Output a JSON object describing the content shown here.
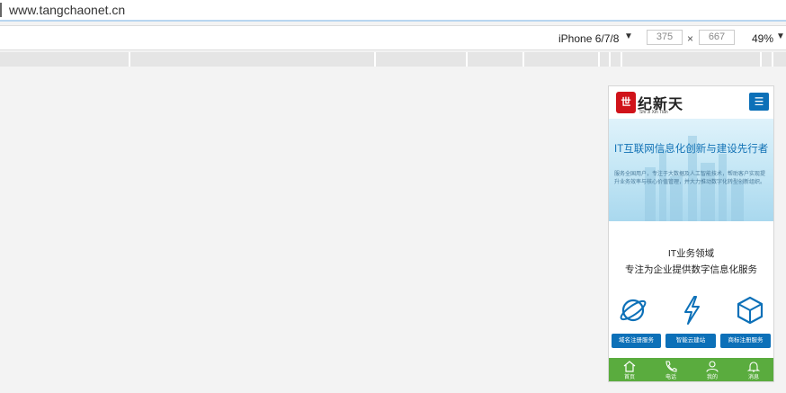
{
  "browser": {
    "url": "www.tangchaonet.cn"
  },
  "devtools": {
    "device": "iPhone 6/7/8",
    "width": "375",
    "height": "667",
    "times": "×",
    "zoom": "49%"
  },
  "site": {
    "logo_text": "纪新天",
    "logo_sub": "Shi Ji Xin Tian",
    "banner": {
      "title": "IT互联网信息化创新与建设先行者",
      "desc": "服务全国用户，专注于大数据及人工智能技术，帮助客户实现提升业务效率与核心价值管理，并大力推动数字化转型创新组织。"
    },
    "section": {
      "title": "IT业务领域",
      "subtitle": "专注为企业提供数字信息化服务"
    },
    "features": [
      {
        "label": "域名注册服务",
        "icon": "planet-icon"
      },
      {
        "label": "智能云建站",
        "icon": "lightning-icon"
      },
      {
        "label": "商标注册服务",
        "icon": "cube-icon"
      }
    ],
    "tabs": [
      {
        "label": "首页",
        "icon": "home-icon"
      },
      {
        "label": "电话",
        "icon": "phone-icon"
      },
      {
        "label": "我的",
        "icon": "user-icon"
      },
      {
        "label": "消息",
        "icon": "bell-icon"
      }
    ]
  },
  "colors": {
    "primary": "#0c70b8",
    "tabbar": "#5aac3e",
    "logo_red": "#d0131a"
  }
}
